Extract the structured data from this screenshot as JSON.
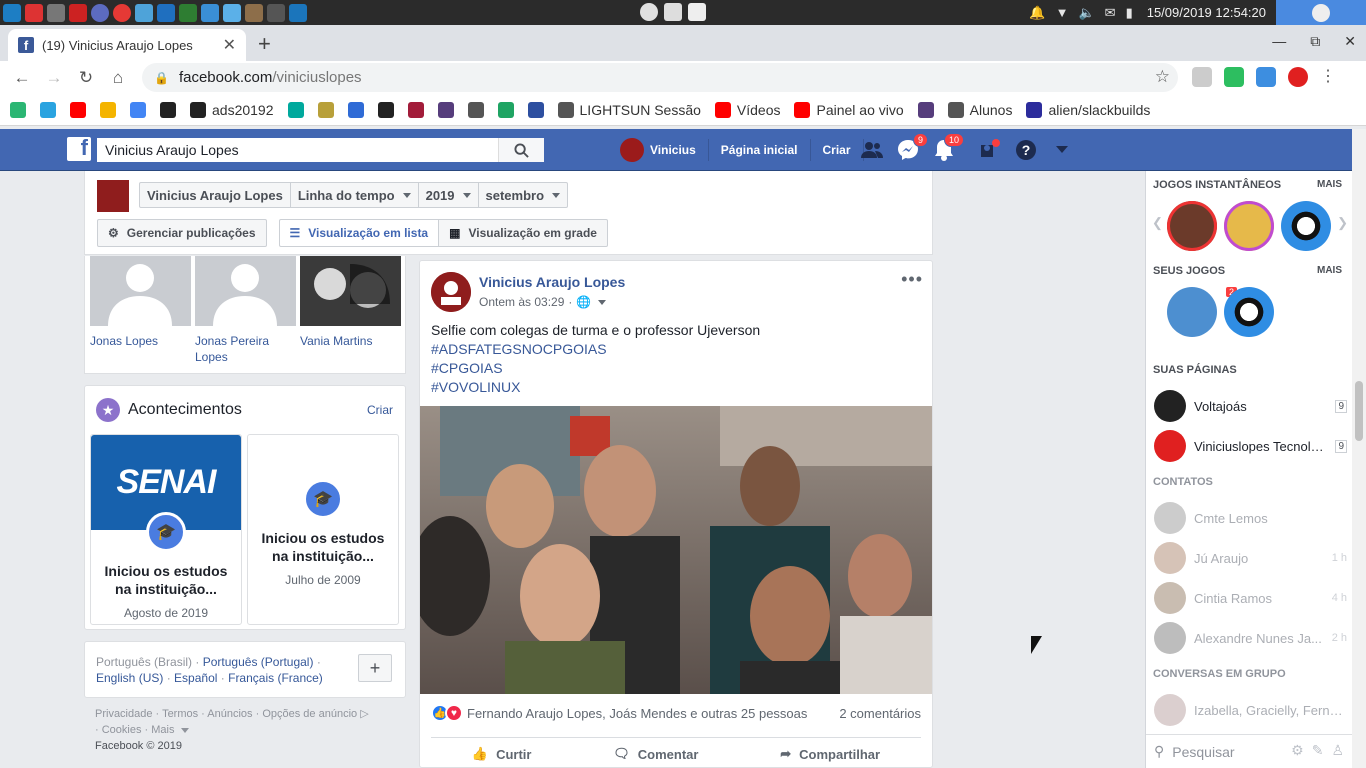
{
  "os": {
    "clock": "15/09/2019 12:54:20"
  },
  "browser": {
    "tab_title": "(19) Vinicius Araujo Lopes",
    "url_host": "facebook.com",
    "url_path": "/viniciuslopes",
    "bookmarks": [
      {
        "label": "",
        "icon": "badge-25-icon",
        "color": "#2bb673"
      },
      {
        "label": "",
        "icon": "telegram-icon",
        "color": "#2aa3e0"
      },
      {
        "label": "",
        "icon": "youtube-icon",
        "color": "#ff0000"
      },
      {
        "label": "",
        "icon": "drive-icon",
        "color": "#f4b400"
      },
      {
        "label": "",
        "icon": "translate-icon",
        "color": "#4285f4"
      },
      {
        "label": "",
        "icon": "github-icon",
        "color": "#222222"
      },
      {
        "label": "ads20192",
        "icon": "github-icon",
        "color": "#222222"
      },
      {
        "label": "",
        "icon": "sync-icon",
        "color": "#00a99d"
      },
      {
        "label": "",
        "icon": "grid-icon",
        "color": "#b8a03a"
      },
      {
        "label": "",
        "icon": "d-icon",
        "color": "#2f6bd6"
      },
      {
        "label": "",
        "icon": "penguin-icon",
        "color": "#222222"
      },
      {
        "label": "",
        "icon": "w-icon",
        "color": "#a21c3a"
      },
      {
        "label": "",
        "icon": "b-icon",
        "color": "#563d7c"
      },
      {
        "label": "",
        "icon": "globe-icon",
        "color": "#555555"
      },
      {
        "label": "",
        "icon": "chat-icon",
        "color": "#1fa463"
      },
      {
        "label": "",
        "icon": "flag-icon",
        "color": "#2d4fa0"
      },
      {
        "label": "LIGHTSUN Sessão",
        "icon": "globe-icon",
        "color": "#555555"
      },
      {
        "label": "Vídeos",
        "icon": "youtube-icon",
        "color": "#ff0000"
      },
      {
        "label": "Painel ao vivo",
        "icon": "youtube-icon",
        "color": "#ff0000"
      },
      {
        "label": "",
        "icon": "b-icon",
        "color": "#563d7c"
      },
      {
        "label": "Alunos",
        "icon": "globe-icon",
        "color": "#555555"
      },
      {
        "label": "alien/slackbuilds",
        "icon": "slackware-icon",
        "color": "#2c2c9c"
      }
    ]
  },
  "fb": {
    "search_value": "Vinicius Araujo Lopes",
    "nav": {
      "profile": "Vinicius",
      "home": "Página inicial",
      "create": "Criar"
    },
    "badges": {
      "messages": "9",
      "notifications": "10"
    },
    "brand_color": "#4267b2"
  },
  "timeline": {
    "name": "Vinicius Araujo Lopes",
    "section": "Linha do tempo",
    "year": "2019",
    "month": "setembro",
    "manage": "Gerenciar publicações",
    "list_view": "Visualização em lista",
    "grid_view": "Visualização em grade"
  },
  "friends": [
    {
      "name": "Jonas Lopes"
    },
    {
      "name": "Jonas Pereira Lopes"
    },
    {
      "name": "Vania Martins"
    }
  ],
  "events": {
    "title": "Acontecimentos",
    "create": "Criar",
    "cards": [
      {
        "title": "Iniciou os estudos na instituição...",
        "date": "Agosto de 2019",
        "logo_text": "SENAI"
      },
      {
        "title": "Iniciou os estudos na instituição...",
        "date": "Julho de 2009"
      }
    ]
  },
  "languages": {
    "current": "Português (Brasil)",
    "others": [
      "Português (Portugal)",
      "English (US)",
      "Español",
      "Français (France)"
    ]
  },
  "footer": {
    "links": [
      "Privacidade",
      "Termos",
      "Anúncios",
      "Opções de anúncio",
      "Cookies",
      "Mais"
    ],
    "copyright": "Facebook © 2019"
  },
  "post": {
    "author": "Vinicius Araujo Lopes",
    "time": "Ontem às 03:29",
    "text": "Selfie com colegas de turma e o professor Ujeverson",
    "hashtags": [
      "#ADSFATEGSNOCPGOIAS",
      "#CPGOIAS",
      "#VOVOLINUX"
    ],
    "reactions": "Fernando Araujo Lopes, Joás Mendes e outras 25 pessoas",
    "comments": "2 comentários",
    "actions": {
      "like": "Curtir",
      "comment": "Comentar",
      "share": "Compartilhar"
    }
  },
  "sidebar": {
    "instant_games": "JOGOS INSTANTÂNEOS",
    "your_games": "SEUS JOGOS",
    "more": "MAIS",
    "game_badge": "2",
    "pages_title": "SUAS PÁGINAS",
    "pages": [
      {
        "name": "Voltajoás",
        "count": "9"
      },
      {
        "name": "Viniciuslopes Tecnolo...",
        "count": "9"
      }
    ],
    "contacts_title": "CONTATOS",
    "contacts": [
      {
        "name": "Cmte Lemos",
        "time": ""
      },
      {
        "name": "Jú Araujo",
        "time": "1 h"
      },
      {
        "name": "Cintia Ramos",
        "time": "4 h"
      },
      {
        "name": "Alexandre Nunes Ja...",
        "time": "2 h"
      }
    ],
    "groups_title": "CONVERSAS EM GRUPO",
    "group": "Izabella, Gracielly, Fernan...",
    "search_placeholder": "Pesquisar"
  }
}
